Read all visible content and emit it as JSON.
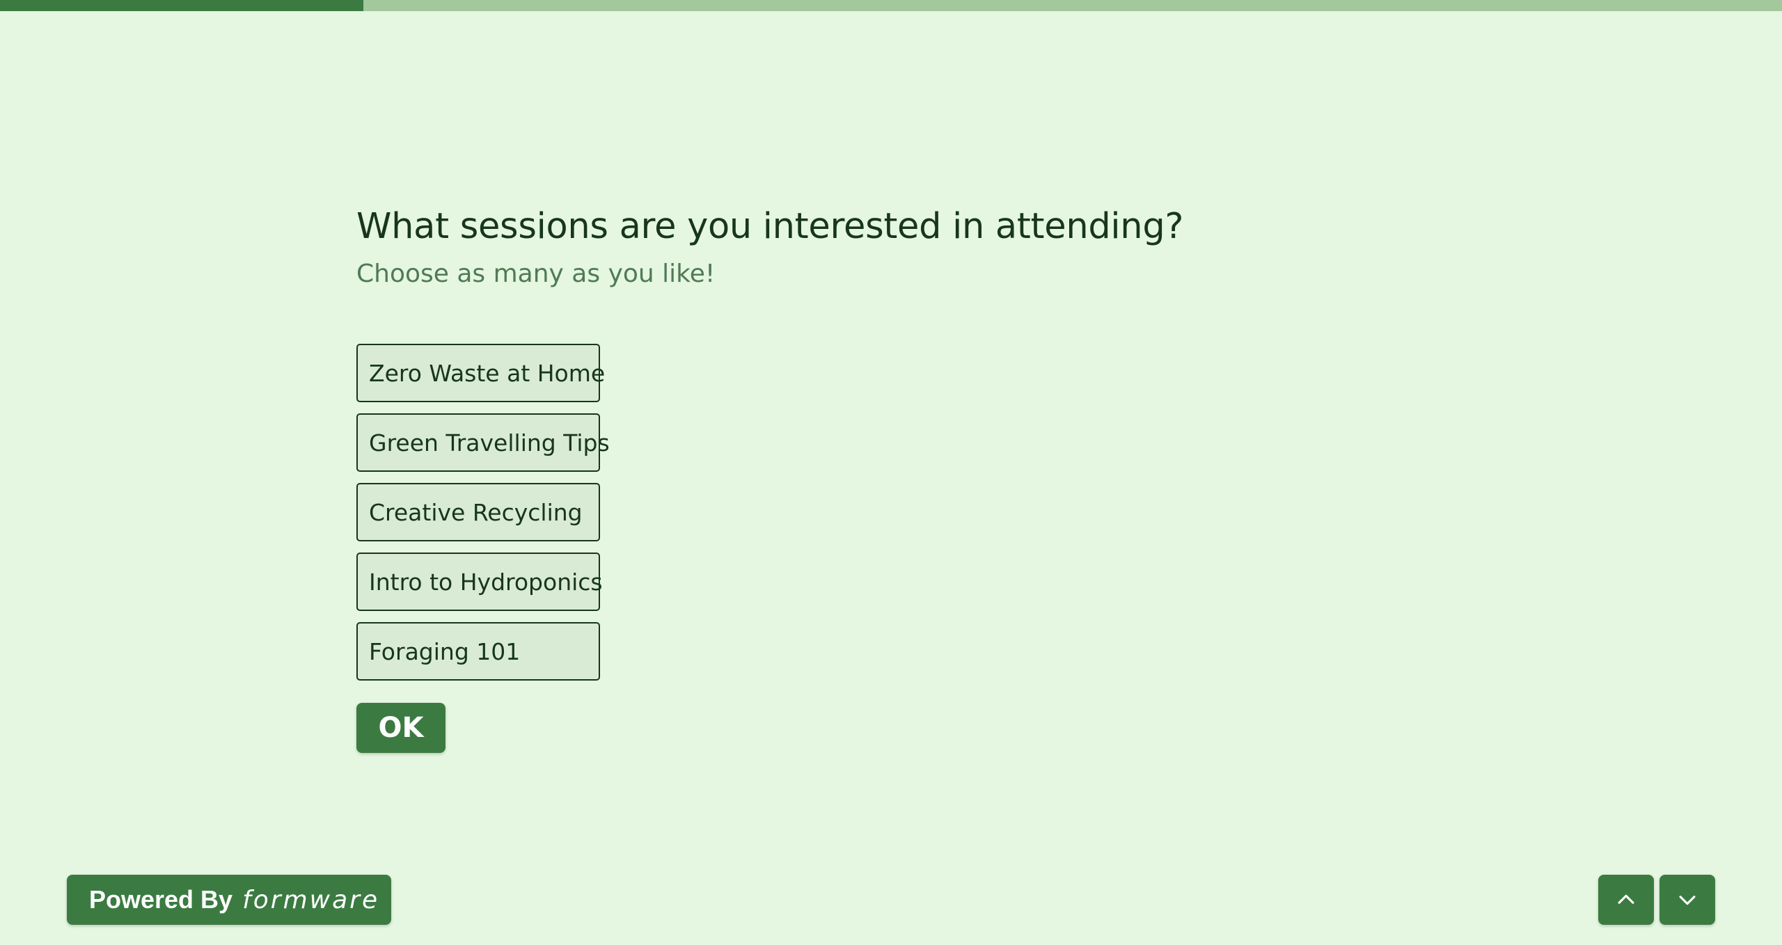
{
  "progress": {
    "value_fraction": 0.204,
    "fill_color": "#3b7b41",
    "track_color": "#a2c89c"
  },
  "question": {
    "title": "What sessions are you interested in attending?",
    "subtitle": "Choose as many as you like!"
  },
  "options": [
    {
      "label": "Zero Waste at Home"
    },
    {
      "label": "Green Travelling Tips"
    },
    {
      "label": "Creative Recycling"
    },
    {
      "label": "Intro to Hydroponics"
    },
    {
      "label": "Foraging 101"
    }
  ],
  "ok_button": {
    "label": "OK"
  },
  "footer": {
    "powered_by_label": "Powered By",
    "brand": "formware",
    "nav_up_icon": "chevron-up-icon",
    "nav_down_icon": "chevron-down-icon"
  },
  "colors": {
    "background": "#e5f6e1",
    "accent": "#3b7b41",
    "text": "#17361c",
    "subtext": "#507a56",
    "option_background": "#d9ebd5"
  }
}
